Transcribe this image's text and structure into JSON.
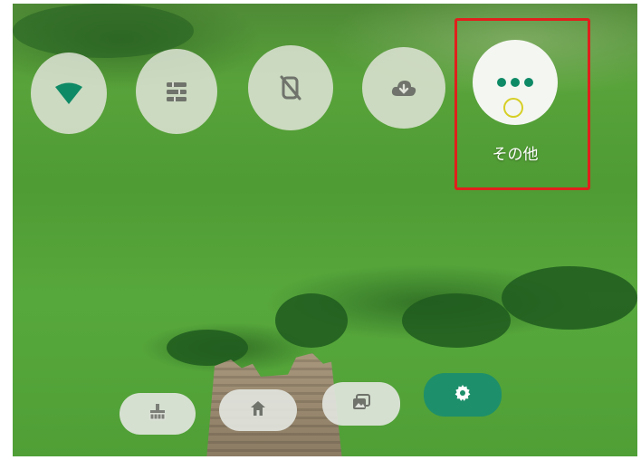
{
  "quick_settings": {
    "wifi": {
      "icon": "wifi-icon"
    },
    "list": {
      "icon": "list-icon"
    },
    "notifications_off": {
      "icon": "notifications-off-icon"
    },
    "cloud_download": {
      "icon": "cloud-download-icon"
    },
    "more": {
      "icon": "more-dots-icon",
      "label": "その他"
    }
  },
  "bottom_nav": [
    {
      "icon": "cleaner-brush-icon",
      "active": false
    },
    {
      "icon": "home-icon",
      "active": false
    },
    {
      "icon": "gallery-icon",
      "active": false
    },
    {
      "icon": "settings-gear-icon",
      "active": true
    }
  ],
  "colors": {
    "accent_teal": "#1d8f6b",
    "highlight_red": "#e0201c",
    "focus_ring_yellow": "#d6cf25"
  }
}
